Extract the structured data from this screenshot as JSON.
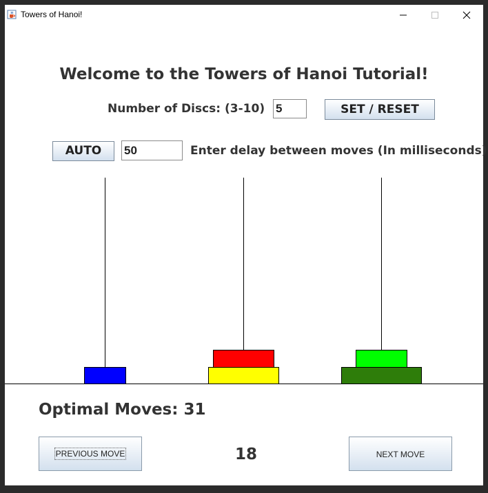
{
  "window": {
    "title": "Towers of Hanoi!",
    "icon": "java-cup-icon"
  },
  "heading": "Welcome to the Towers of Hanoi Tutorial!",
  "discs_row": {
    "label": "Number of Discs: (3-10)",
    "value": "5",
    "set_reset_label": "SET / RESET"
  },
  "auto_row": {
    "auto_label": "AUTO",
    "delay_value": "50",
    "delay_label": "Enter delay between moves (In milliseconds)"
  },
  "towers": {
    "pegs": [
      "left",
      "middle",
      "right"
    ],
    "disc_colors": {
      "blue": "#0000ff",
      "red": "#ff0000",
      "yellow": "#ffff00",
      "lime": "#00ff00",
      "dark_green": "#2e7d0a"
    },
    "stacks": {
      "left": [
        "blue"
      ],
      "middle": [
        "yellow",
        "red"
      ],
      "right": [
        "dark_green",
        "lime"
      ]
    }
  },
  "optimal_moves": "Optimal Moves: 31",
  "navigation": {
    "previous_label": "PREVIOUS MOVE",
    "next_label": "NEXT MOVE",
    "move_count": "18"
  }
}
